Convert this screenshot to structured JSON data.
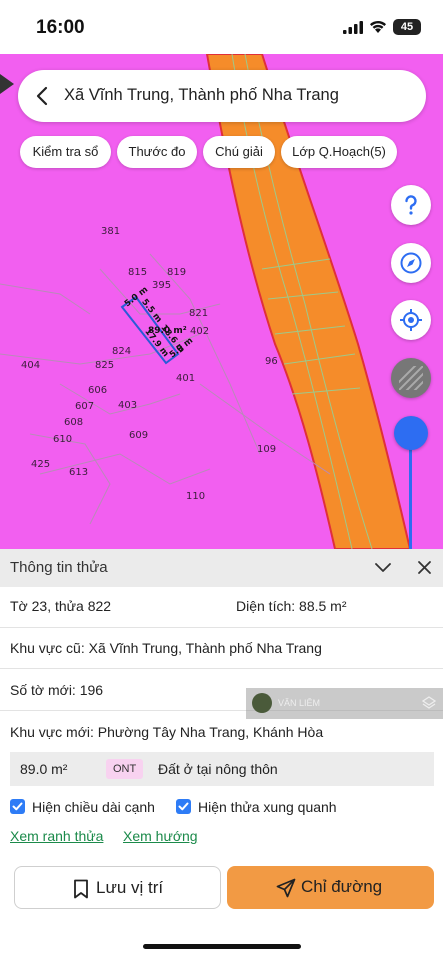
{
  "status_bar": {
    "time": "16:00",
    "battery": "45"
  },
  "search": {
    "title": "Xã Vĩnh Trung, Thành phố Nha Trang"
  },
  "chips": [
    "Kiểm tra sổ",
    "Thước đo",
    "Chú giải",
    "Lớp Q.Hoạch(5)"
  ],
  "map": {
    "zone_color": "#f25ff0",
    "road_color": "#f58c2a",
    "parcel_numbers": [
      "381",
      "815",
      "819",
      "395",
      "821",
      "402",
      "824",
      "825",
      "404",
      "96",
      "401",
      "606",
      "607",
      "403",
      "608",
      "610",
      "609",
      "109",
      "425",
      "613",
      "110"
    ],
    "selected_parcel": {
      "area_label": "89.0 m²",
      "edge_labels": [
        "5.0 m",
        "5.5 m",
        "18.6 m",
        "17.9 m",
        "5.0 m"
      ]
    }
  },
  "tools": {
    "help_icon": "question-icon",
    "compass_icon": "compass-icon",
    "locate_icon": "locate-icon",
    "opacity_slider_value": 0.95
  },
  "panel": {
    "title": "Thông tin thửa",
    "sheet_parcel": "Tờ 23, thửa 822",
    "area": "Diện tích: 88.5 m²",
    "old_area": "Khu vực cũ: Xã Vĩnh Trung, Thành phố Nha Trang",
    "new_sheet": "Số tờ mới: 196",
    "new_area": "Khu vực mới: Phường Tây Nha Trang, Khánh Hòa",
    "land": {
      "area": "89.0 m²",
      "code": "ONT",
      "type": "Đất ở tại nông thôn"
    },
    "checkbox_edges": {
      "label": "Hiện chiều dài cạnh",
      "checked": true
    },
    "checkbox_neighbors": {
      "label": "Hiện thửa xung quanh",
      "checked": true
    },
    "link_boundary": "Xem ranh thửa",
    "link_direction": "Xem hướng",
    "save_button": "Lưu vị trí",
    "directions_button": "Chỉ đường"
  },
  "watermark": {
    "name": "VĂN LIÊM"
  }
}
